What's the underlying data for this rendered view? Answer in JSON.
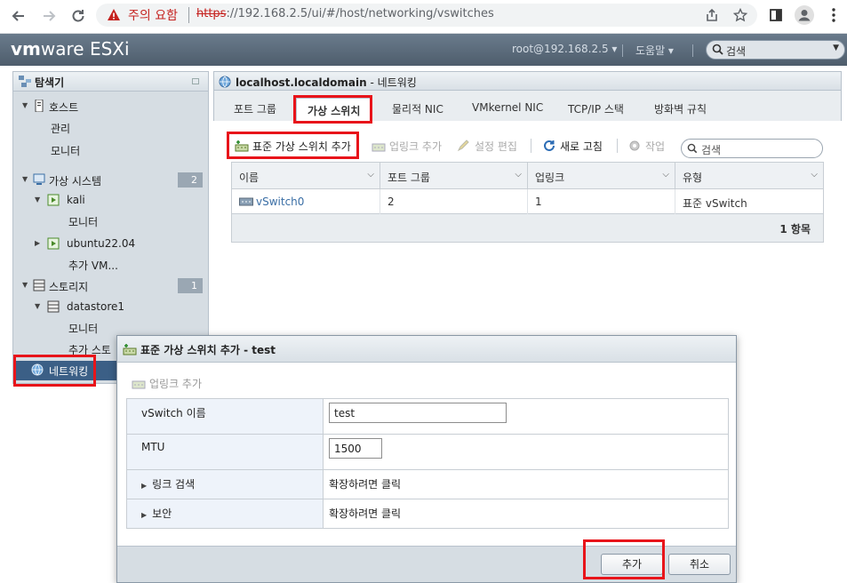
{
  "browser": {
    "warning_text": "주의 요함",
    "url_scheme": "https",
    "url_rest": "://192.168.2.5/ui/#/host/networking/vswitches"
  },
  "header": {
    "logo_vm": "vm",
    "logo_rest": "ware ESXi",
    "user": "root@192.168.2.5 ▾",
    "help": "도움말 ▾",
    "search_placeholder": "검색"
  },
  "navigator": {
    "title": "탐색기",
    "items": [
      {
        "label": "호스트"
      },
      {
        "label": "관리"
      },
      {
        "label": "모니터"
      },
      {
        "label": "가상 시스템",
        "count": "2"
      },
      {
        "label": "kali"
      },
      {
        "label": "모니터"
      },
      {
        "label": "ubuntu22.04"
      },
      {
        "label": "추가 VM..."
      },
      {
        "label": "스토리지",
        "count": "1"
      },
      {
        "label": "datastore1"
      },
      {
        "label": "모니터"
      },
      {
        "label": "추가 스토"
      },
      {
        "label": "네트워킹"
      }
    ]
  },
  "main": {
    "title_bold": "localhost.localdomain",
    "title_rest": " - 네트워킹",
    "tabs": [
      "포트 그룹",
      "가상 스위치",
      "물리적 NIC",
      "VMkernel NIC",
      "TCP/IP 스택",
      "방화벽 규칙"
    ],
    "toolbar": {
      "add_switch": "표준 가상 스위치 추가",
      "add_uplink": "업링크 추가",
      "edit_settings": "설정 편집",
      "refresh": "새로 고침",
      "actions": "작업",
      "search_placeholder": "검색"
    },
    "grid": {
      "columns": [
        "이름",
        "포트 그룹",
        "업링크",
        "유형"
      ],
      "rows": [
        {
          "name": "vSwitch0",
          "port_groups": "2",
          "uplinks": "1",
          "type": "표준 vSwitch"
        }
      ],
      "footer": "1 항목"
    }
  },
  "modal": {
    "title": "표준 가상 스위치 추가 - test",
    "add_uplink": "업링크 추가",
    "fields": {
      "vswitch_name_label": "vSwitch 이름",
      "vswitch_name_value": "test",
      "mtu_label": "MTU",
      "mtu_value": "1500",
      "link_discovery_label": "링크 검색",
      "link_discovery_value": "확장하려면 클릭",
      "security_label": "보안",
      "security_value": "확장하려면 클릭"
    },
    "add_button": "추가",
    "cancel_button": "취소"
  },
  "colors": {
    "highlight": "#e8141a",
    "header_bg": "#5b6b7b",
    "selected_nav": "#3b5f86",
    "link": "#3a6ea5"
  }
}
